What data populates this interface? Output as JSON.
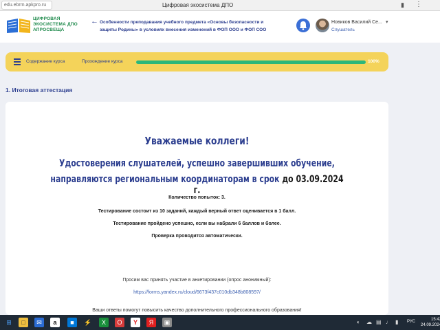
{
  "browser": {
    "url": "edu.ebrm.apkpro.ru",
    "tab_title": "Цифровая экосистема ДПО"
  },
  "header": {
    "logo_line1": "ЦИФРОВАЯ",
    "logo_line2": "ЭКОСИСТЕМА ДПО",
    "logo_line3": "АПРОСВЕЩА",
    "course_title": "Особенности преподавания учебного предмета «Основы безопасности и защиты Родины» в условиях внесения изменений в ФОП ООО и ФОП СОО",
    "user_name": "Новиков Василий Се...",
    "user_role": "Слушатель"
  },
  "nav": {
    "content_label": "Содержание курса",
    "progress_label": "Прохождение курса",
    "progress_value": 100,
    "progress_text": "100%"
  },
  "section": {
    "title": "1. Итоговая аттестация"
  },
  "card": {
    "greeting": "Уважаемые коллеги!",
    "lead_line1": "Удостоверения слушателей, успешно завершивших обучение,",
    "lead_line2_start": "направляются региональным координаторам в срок ",
    "lead_line2_date": "до 03.09.2024 г.",
    "attempts": "Количество попыток: 3.",
    "testing_info": "Тестирование состоит из 10 заданий, каждый верный ответ оценивается в 1 балл.",
    "pass_info": "Тестирование пройдено успешно, если вы набрали 6 баллов и более.",
    "auto_check": "Проверка проводится автоматически.",
    "survey_text": "Просим вас принять участие в анкетировании (опрос анонимный):",
    "survey_link": "https://forms.yandex.ru/cloud/6673f437c010db348b808597/",
    "cut_text": "Ваши ответы помогут повысить качество дополнительного профессионального образования!"
  },
  "taskbar": {
    "lang": "РУС",
    "time": "15:42",
    "date": "24.09.2024"
  },
  "colors": {
    "accent": "#2c3e8f",
    "nav_bg": "#f4d35a",
    "progress": "#2bb77a"
  }
}
